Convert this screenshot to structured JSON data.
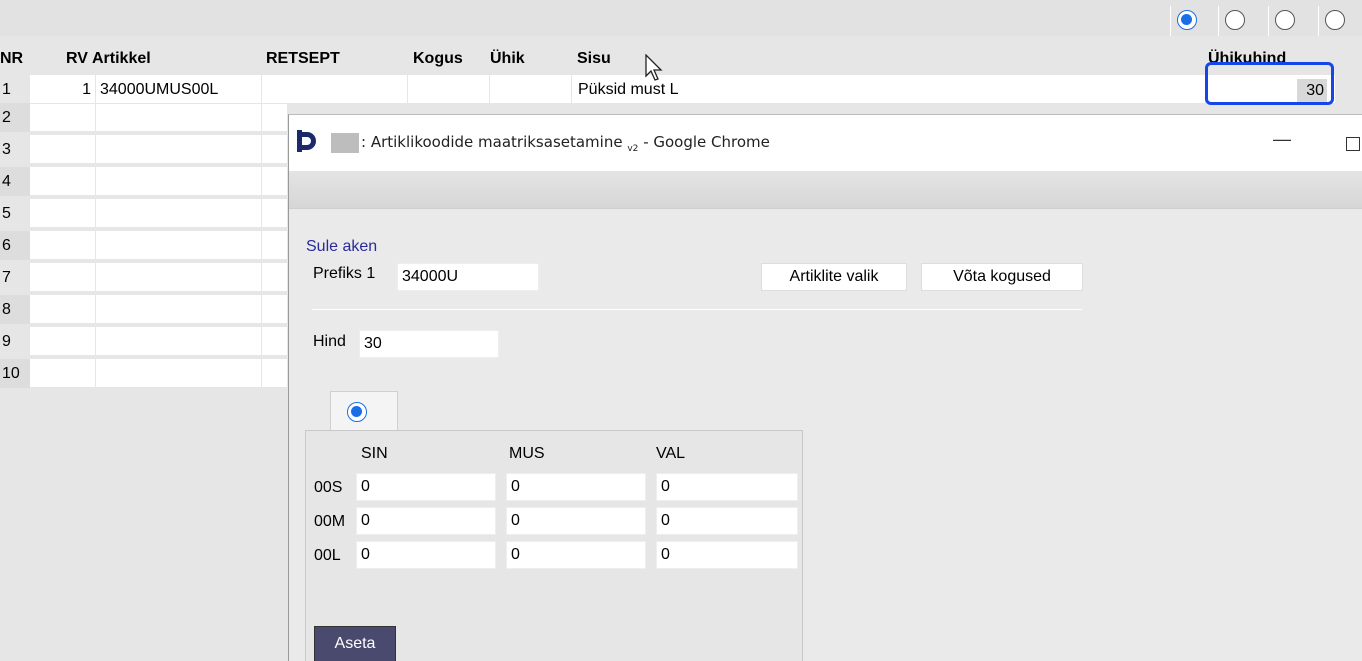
{
  "top_radios": [
    {
      "checked": true
    },
    {
      "checked": false
    },
    {
      "checked": false
    },
    {
      "checked": false
    }
  ],
  "grid": {
    "headers": {
      "nr": "NR",
      "rv": "RV",
      "artikkel": "Artikkel",
      "retsept": "RETSEPT",
      "kogus": "Kogus",
      "uhik": "Ühik",
      "sisu": "Sisu",
      "uhikuhind": "Ühikuhind"
    },
    "row1": {
      "nr": "1",
      "rv": "1",
      "artikkel": "34000UMUS00L",
      "sisu": "Püksid must L",
      "uhikuhind": "30"
    },
    "row_numbers": [
      "2",
      "3",
      "4",
      "5",
      "6",
      "7",
      "8",
      "9",
      "10"
    ]
  },
  "popup": {
    "title": ": Artiklikoodide maatriksasetamine",
    "title_version": "v2",
    "title_suffix": " - Google Chrome",
    "minimize": "—",
    "close_link": "Sule aken",
    "prefiks_label": "Prefiks 1",
    "prefiks_value": "34000U",
    "btn_artiklite_valik": "Artiklite valik",
    "btn_vota_kogused": "Võta kogused",
    "hind_label": "Hind",
    "hind_value": "30",
    "matrix": {
      "columns": [
        "SIN",
        "MUS",
        "VAL"
      ],
      "rows": [
        {
          "label": "00S",
          "values": [
            "0",
            "0",
            "0"
          ]
        },
        {
          "label": "00M",
          "values": [
            "0",
            "0",
            "0"
          ]
        },
        {
          "label": "00L",
          "values": [
            "0",
            "0",
            "0"
          ]
        }
      ]
    },
    "btn_aseta": "Aseta"
  },
  "colors": {
    "accent": "#1a6fe6",
    "highlight": "#1546e8",
    "link": "#2a2a9a",
    "aseta_bg": "#4a4a6e"
  }
}
